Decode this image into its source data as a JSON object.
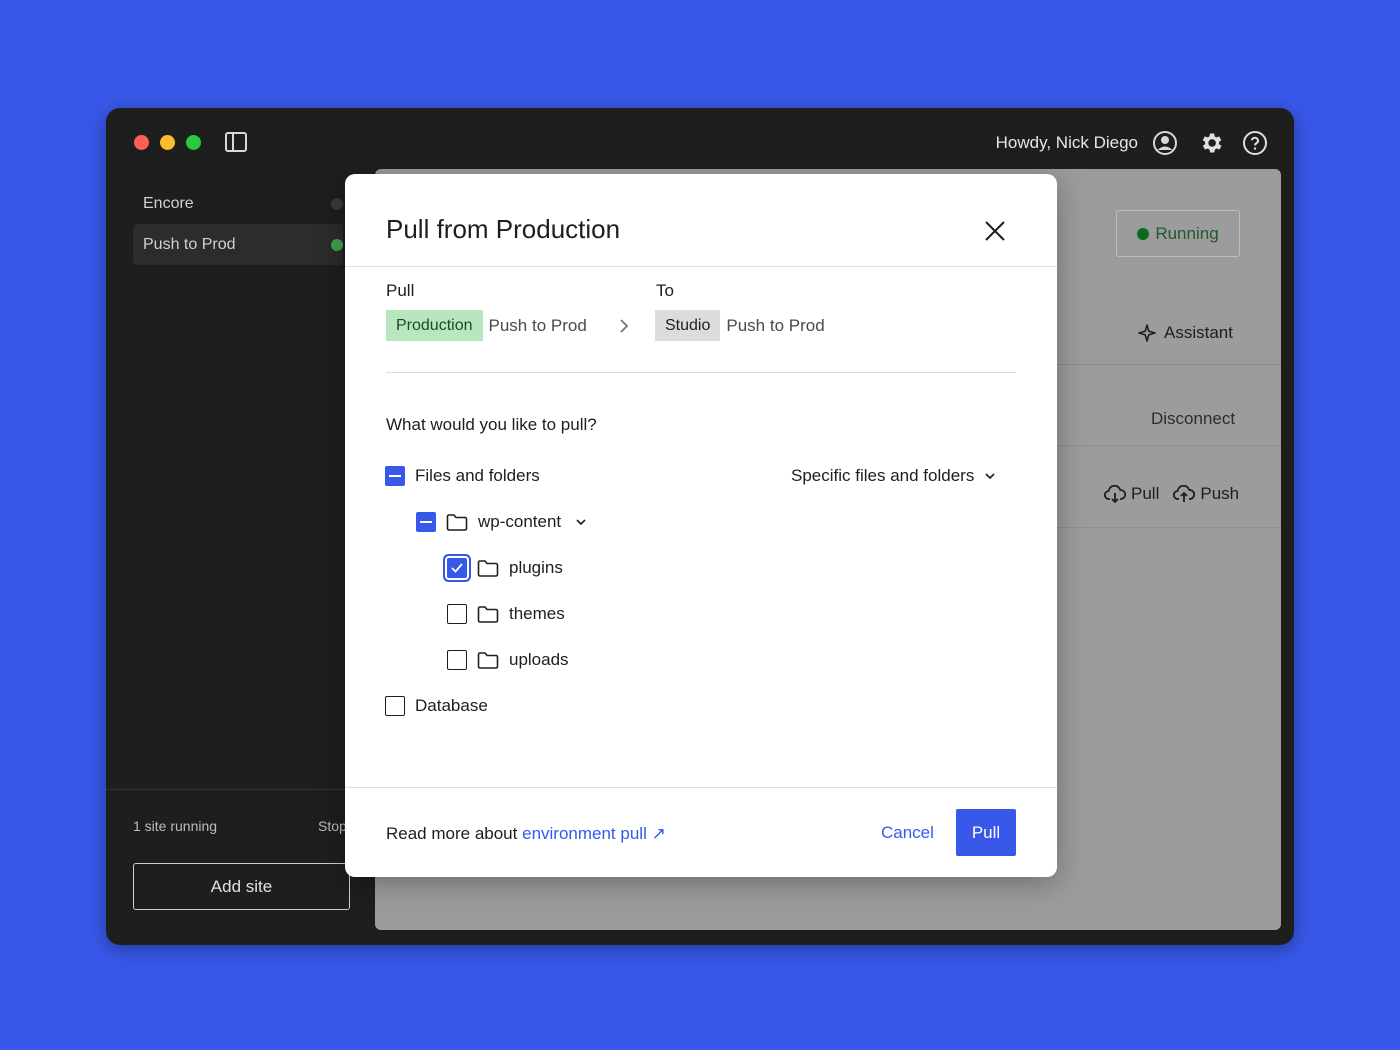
{
  "topbar": {
    "greeting": "Howdy, Nick Diego",
    "icons": [
      "avatar-icon",
      "gear-icon",
      "help-icon"
    ]
  },
  "sidebar": {
    "sites": [
      {
        "name": "Encore",
        "status": "stopped",
        "active": false
      },
      {
        "name": "Push to Prod",
        "status": "running",
        "active": true
      }
    ],
    "sites_running": "1 site running",
    "stop_all": "Stop",
    "add_site": "Add site"
  },
  "main": {
    "status": "Running",
    "assistant": "Assistant",
    "disconnect": "Disconnect",
    "pull": "Pull",
    "push": "Push"
  },
  "modal": {
    "title": "Pull from Production",
    "pull_label": "Pull",
    "to_label": "To",
    "from_env": {
      "tag": "Production",
      "site": "Push to Prod"
    },
    "to_env": {
      "tag": "Studio",
      "site": "Push to Prod"
    },
    "question": "What would you like to pull?",
    "files_label": "Files and folders",
    "scope_select": "Specific files and folders",
    "tree": {
      "root": "wp-content",
      "children": [
        {
          "name": "plugins",
          "checked": true
        },
        {
          "name": "themes",
          "checked": false
        },
        {
          "name": "uploads",
          "checked": false
        }
      ]
    },
    "database_label": "Database",
    "read_more_prefix": "Read more about",
    "read_more_link": "environment pull ↗",
    "cancel": "Cancel",
    "submit": "Pull"
  },
  "colors": {
    "accent": "#3858e9",
    "running": "#0b6b1d",
    "production_tag": "#b8e6bf",
    "studio_tag": "#dcdcde"
  }
}
